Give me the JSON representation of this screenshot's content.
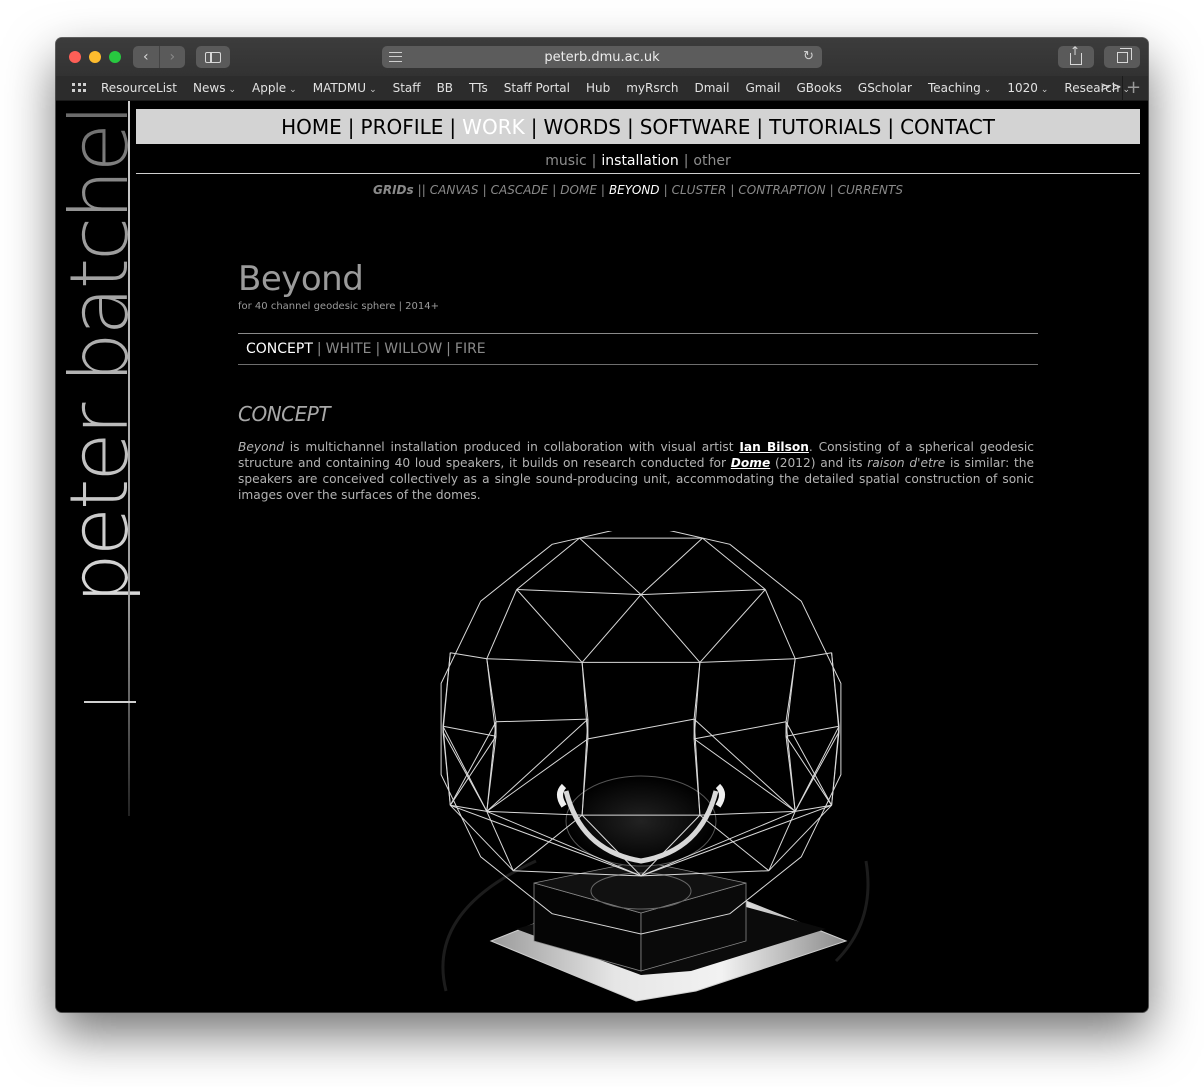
{
  "browser": {
    "url": "peterb.dmu.ac.uk",
    "bookmarks": [
      {
        "label": "ResourceList",
        "menu": false
      },
      {
        "label": "News",
        "menu": true
      },
      {
        "label": "Apple",
        "menu": true
      },
      {
        "label": "MATDMU",
        "menu": true
      },
      {
        "label": "Staff",
        "menu": false
      },
      {
        "label": "BB",
        "menu": false
      },
      {
        "label": "TTs",
        "menu": false
      },
      {
        "label": "Staff Portal",
        "menu": false
      },
      {
        "label": "Hub",
        "menu": false
      },
      {
        "label": "myRsrch",
        "menu": false
      },
      {
        "label": "Dmail",
        "menu": false
      },
      {
        "label": "Gmail",
        "menu": false
      },
      {
        "label": "GBooks",
        "menu": false
      },
      {
        "label": "GScholar",
        "menu": false
      },
      {
        "label": "Teaching",
        "menu": true
      },
      {
        "label": "1020",
        "menu": true
      },
      {
        "label": "Research",
        "menu": true
      }
    ],
    "more_label": ">>"
  },
  "site": {
    "author": "peter batchelor",
    "main_nav": [
      {
        "label": "HOME",
        "active": false
      },
      {
        "label": "PROFILE",
        "active": false
      },
      {
        "label": "WORK",
        "active": true
      },
      {
        "label": "WORDS",
        "active": false
      },
      {
        "label": "SOFTWARE",
        "active": false
      },
      {
        "label": "TUTORIALS",
        "active": false
      },
      {
        "label": "CONTACT",
        "active": false
      }
    ],
    "main_nav_sep": "|",
    "sub_nav": [
      {
        "label": "music",
        "active": false
      },
      {
        "label": "installation",
        "active": true
      },
      {
        "label": "other",
        "active": false
      }
    ],
    "work_nav_head": "GRIDs",
    "work_nav_head_sep": "||",
    "work_nav": [
      {
        "label": "CANVAS",
        "active": false
      },
      {
        "label": "CASCADE",
        "active": false
      },
      {
        "label": "DOME",
        "active": false
      },
      {
        "label": "BEYOND",
        "active": true
      },
      {
        "label": "CLUSTER",
        "active": false
      },
      {
        "label": "CONTRAPTION",
        "active": false
      },
      {
        "label": "CURRENTS",
        "active": false
      }
    ]
  },
  "work": {
    "title": "Beyond",
    "subtitle": "for 40 channel geodesic sphere | 2014+",
    "piece_nav": [
      {
        "label": "CONCEPT",
        "active": true
      },
      {
        "label": "WHITE",
        "active": false
      },
      {
        "label": "WILLOW",
        "active": false
      },
      {
        "label": "FIRE",
        "active": false
      }
    ],
    "section_title": "CONCEPT",
    "paragraph": {
      "t1": "Beyond",
      "t2": " is multichannel installation produced in collaboration with visual artist ",
      "link1": "Ian Bilson",
      "t3": ". Consisting of a spherical geodesic structure and containing 40 loud speakers, it builds on research conducted for ",
      "link2": "Dome",
      "t4": " (2012) and its ",
      "t5": "raison d'etre",
      "t6": " is similar: the speakers are conceived collectively as a single sound-producing unit, accommodating the detailed spatial construction of sonic images over the surfaces of the domes."
    }
  },
  "colors": {
    "page_bg": "#000000",
    "nav_bar_bg": "#d3d3d3",
    "active_link": "#ffffff",
    "muted_text": "#8a8a8a"
  }
}
